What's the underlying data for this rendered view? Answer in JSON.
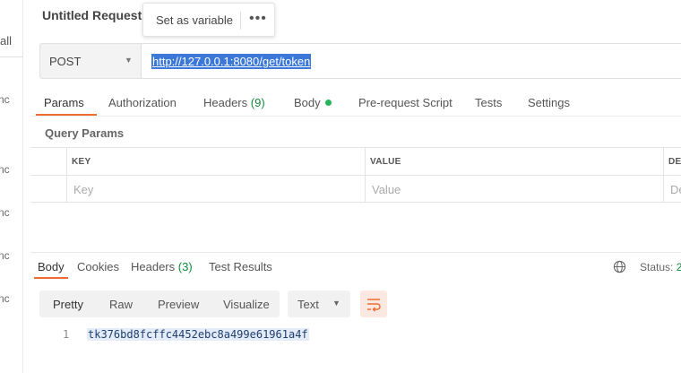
{
  "sidebar": {
    "all_label": "all",
    "items": [
      "nc",
      "nc",
      "nc",
      "nc",
      "nc"
    ]
  },
  "request": {
    "title": "Untitled Request",
    "tooltip": {
      "label": "Set as variable",
      "more_icon": "more-horizontal-icon"
    },
    "method": "POST",
    "url": "http://127.0.0.1:8080/get/token"
  },
  "request_tabs": [
    {
      "label": "Params"
    },
    {
      "label": "Authorization"
    },
    {
      "label": "Headers",
      "count": "(9)"
    },
    {
      "label": "Body"
    },
    {
      "label": "Pre-request Script"
    },
    {
      "label": "Tests"
    },
    {
      "label": "Settings"
    }
  ],
  "query_params": {
    "title": "Query Params",
    "columns": [
      "KEY",
      "VALUE",
      "DE"
    ],
    "placeholders": [
      "Key",
      "Value",
      "De"
    ]
  },
  "response": {
    "tabs": [
      {
        "label": "Body"
      },
      {
        "label": "Cookies"
      },
      {
        "label": "Headers",
        "count": "(3)"
      },
      {
        "label": "Test Results"
      }
    ],
    "status_label": "Status:",
    "status_code": "2",
    "formats": [
      "Pretty",
      "Raw",
      "Preview",
      "Visualize"
    ],
    "type": "Text",
    "line_number": "1",
    "body": "tk376bd8fcffc4452ebc8a499e61961a4f"
  },
  "colors": {
    "accent": "#ef6c30",
    "count_green": "#0f8a3a",
    "dot_green": "#26b35a",
    "url_selection": "#3b78d7"
  }
}
